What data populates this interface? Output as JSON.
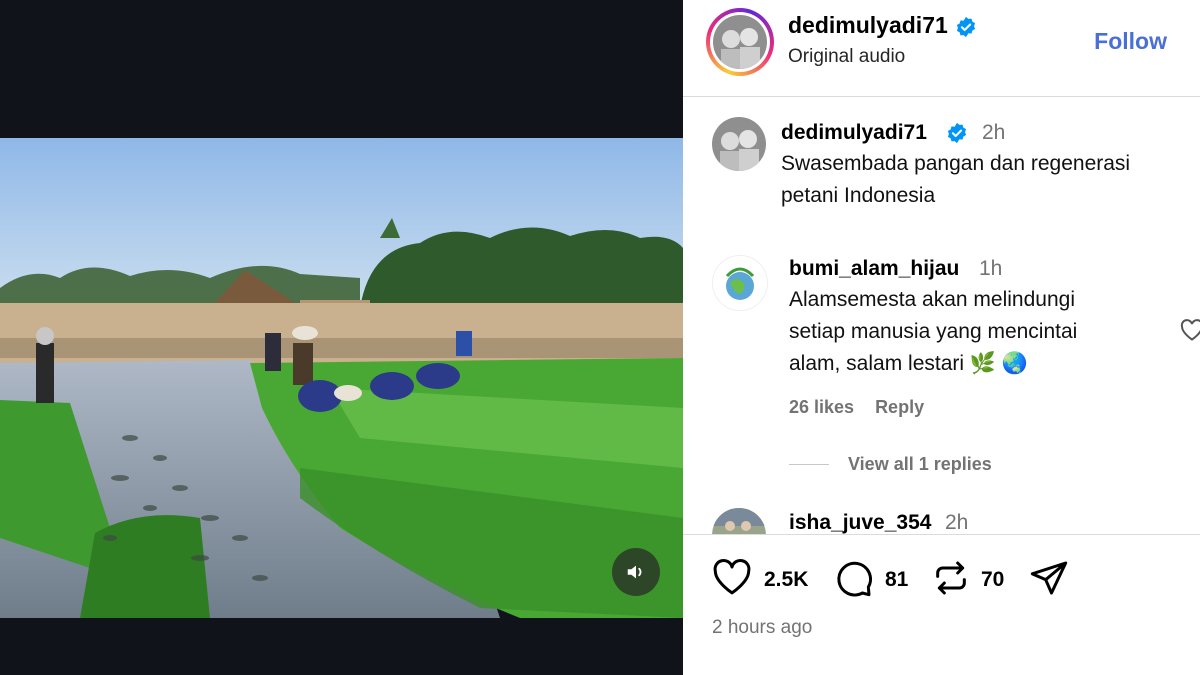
{
  "post": {
    "username": "dedimulyadi71",
    "audio": "Original audio",
    "follow_label": "Follow",
    "caption": {
      "username": "dedimulyadi71",
      "time": "2h",
      "text": "Swasembada pangan dan regenerasi petani Indonesia"
    }
  },
  "comments": [
    {
      "username": "bumi_alam_hijau",
      "time": "1h",
      "text": "Alamsemesta akan melindungi setiap manusia yang mencintai alam, salam lestari 🌿 🌏",
      "likes": "26 likes",
      "reply_label": "Reply",
      "view_replies": "View all 1 replies"
    },
    {
      "username": "isha_juve_354",
      "time": "2h"
    }
  ],
  "actions": {
    "likes": "2.5K",
    "comments": "81",
    "reposts": "70"
  },
  "timestamp": "2 hours ago",
  "colors": {
    "follow": "#4a6fd6",
    "verified": "#0095f6",
    "video_bg": "#10131a"
  },
  "icons": [
    "verified-badge-icon",
    "heart-icon",
    "comment-icon",
    "repost-icon",
    "share-icon",
    "speaker-icon"
  ]
}
